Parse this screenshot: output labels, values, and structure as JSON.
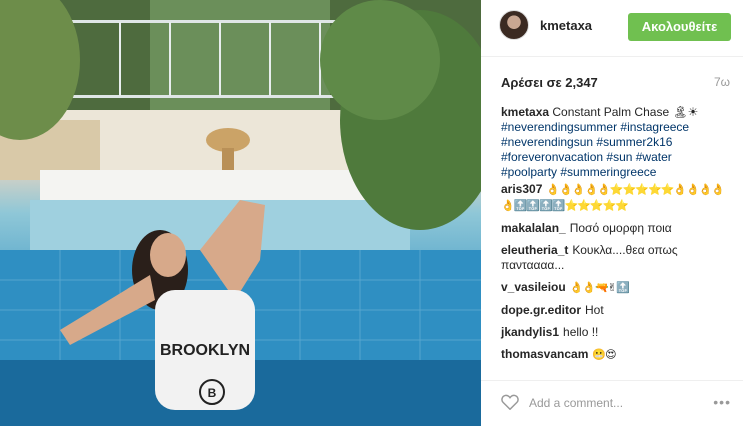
{
  "post": {
    "username": "kmetaxa",
    "follow_label": "Ακολουθείτε",
    "likes_label": "Αρέσει σε 2,347",
    "age": "7ω",
    "caption_text": "Constant Palm Chase 🏝☀",
    "hashtags": [
      "#neverendingsummer #instagreece",
      "#neverendingsun #summer2k16",
      "#foreveronvacation #sun #water",
      "#poolparty #summeringreece"
    ],
    "photo_shirt_text": "BROOKLYN"
  },
  "comments": [
    {
      "user": "aris307",
      "text": "👌👌👌👌👌⭐⭐⭐⭐⭐👌👌👌👌👌🔝🔝🔝🔝⭐⭐⭐⭐⭐"
    },
    {
      "user": "makalalan_",
      "text": "Ποσό ομορφη ποια"
    },
    {
      "user": "eleutheria_t",
      "text": "Κουκλα....θεα οπως πανταααα..."
    },
    {
      "user": "v_vasileiou",
      "text": "👌👌🔫✌🔝"
    },
    {
      "user": "dope.gr.editor",
      "text": "Hot"
    },
    {
      "user": "jkandylis1",
      "text": "hello !!"
    },
    {
      "user": "thomasvancam",
      "text": "😬😍"
    }
  ],
  "footer": {
    "add_comment_placeholder": "Add a comment...",
    "more_label": "•••"
  },
  "icons": {
    "like": "heart-icon",
    "more": "more-options-icon"
  }
}
